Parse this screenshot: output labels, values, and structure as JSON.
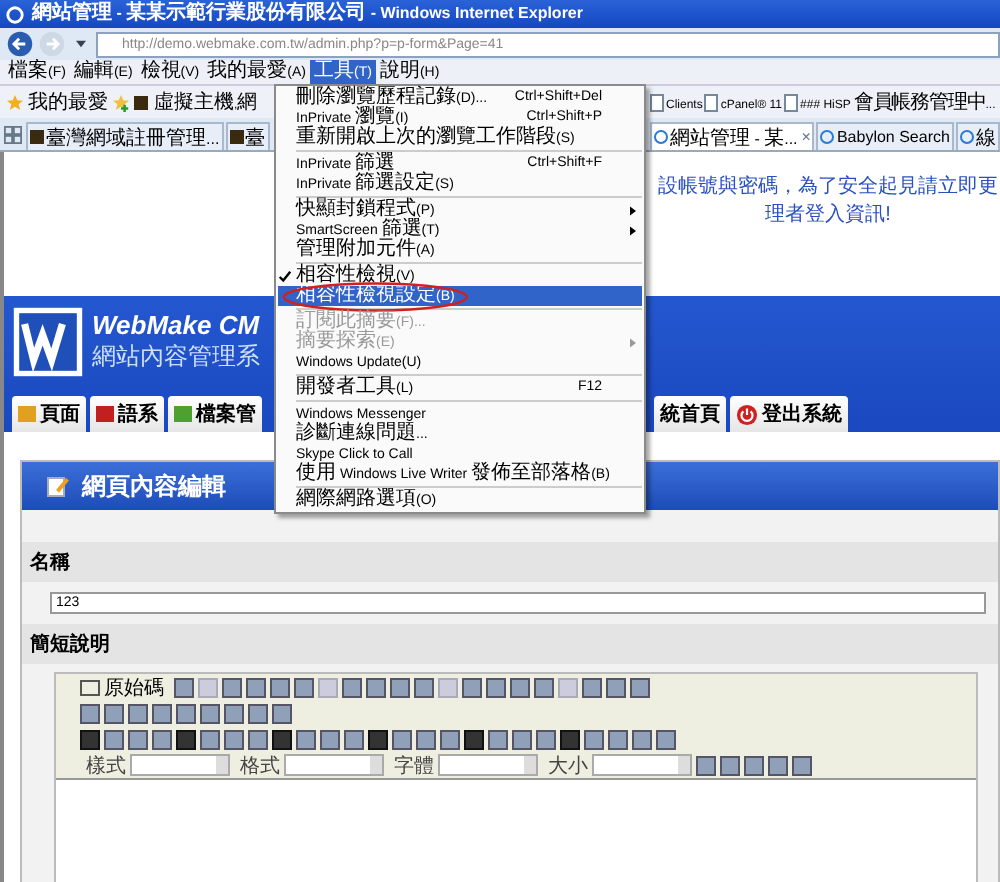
{
  "window": {
    "title": "網站管理 - 某某示範行業股份有限公司 - Windows Internet Explorer"
  },
  "address_bar": {
    "url": "http://demo.webmake.com.tw/admin.php?p=p-form&Page=41"
  },
  "menu_bar": [
    {
      "label": "檔案(F)",
      "selected": false
    },
    {
      "label": "編輯(E)",
      "selected": false
    },
    {
      "label": "檢視(V)",
      "selected": false
    },
    {
      "label": "我的最愛(A)",
      "selected": false
    },
    {
      "label": "工具(T)",
      "selected": true
    },
    {
      "label": "說明(H)",
      "selected": false
    }
  ],
  "favorites_bar": {
    "label": "我的最愛",
    "links_left": [
      "虛擬主機,網"
    ],
    "links_right": [
      "Clients",
      "cPanel® 11",
      "### HiSP 會員帳務管理中..."
    ]
  },
  "browser_tabs_left": [
    {
      "label": "臺灣網域註冊管理...",
      "selected": false
    },
    {
      "label": "臺",
      "selected": false
    }
  ],
  "browser_tabs_right": [
    {
      "label": "網站管理 - 某...",
      "selected": true
    },
    {
      "label": "Babylon Search",
      "selected": false
    },
    {
      "label": "線",
      "selected": false
    }
  ],
  "close_tab": "×",
  "tools_menu": [
    [
      {
        "label": "刪除瀏覽歷程記錄(D)...",
        "shortcut": "Ctrl+Shift+Del",
        "checked": false,
        "selected": false,
        "disabled": false,
        "has_submenu": false,
        "circled": false
      },
      {
        "label": "InPrivate 瀏覽(I)",
        "shortcut": "Ctrl+Shift+P",
        "checked": false,
        "selected": false,
        "disabled": false,
        "has_submenu": false,
        "circled": false
      },
      {
        "label": "重新開啟上次的瀏覽工作階段(S)",
        "checked": false,
        "selected": false,
        "disabled": false,
        "has_submenu": false,
        "circled": false
      }
    ],
    [
      {
        "label": "InPrivate 篩選",
        "shortcut": "Ctrl+Shift+F",
        "checked": false,
        "selected": false,
        "disabled": false,
        "has_submenu": false,
        "circled": false
      },
      {
        "label": "InPrivate 篩選設定(S)",
        "checked": false,
        "selected": false,
        "disabled": false,
        "has_submenu": false,
        "circled": false
      }
    ],
    [
      {
        "label": "快顯封鎖程式(P)",
        "checked": false,
        "selected": false,
        "disabled": false,
        "has_submenu": true,
        "circled": false
      },
      {
        "label": "SmartScreen 篩選(T)",
        "checked": false,
        "selected": false,
        "disabled": false,
        "has_submenu": true,
        "circled": false
      },
      {
        "label": "管理附加元件(A)",
        "checked": false,
        "selected": false,
        "disabled": false,
        "has_submenu": false,
        "circled": false
      }
    ],
    [
      {
        "label": "相容性檢視(V)",
        "checked": true,
        "selected": false,
        "disabled": false,
        "has_submenu": false,
        "circled": false
      },
      {
        "label": "相容性檢視設定(B)",
        "checked": false,
        "selected": true,
        "disabled": false,
        "has_submenu": false,
        "circled": true
      }
    ],
    [
      {
        "label": "訂閱此摘要(F)...",
        "checked": false,
        "selected": false,
        "disabled": true,
        "has_submenu": false,
        "circled": false
      },
      {
        "label": "摘要探索(E)",
        "checked": false,
        "selected": false,
        "disabled": true,
        "has_submenu": true,
        "circled": false
      },
      {
        "label": "Windows Update(U)",
        "checked": false,
        "selected": false,
        "disabled": false,
        "has_submenu": false,
        "circled": false
      }
    ],
    [
      {
        "label": "開發者工具(L)",
        "shortcut": "F12",
        "checked": false,
        "selected": false,
        "disabled": false,
        "has_submenu": false,
        "circled": false
      }
    ],
    [
      {
        "label": "Windows Messenger",
        "checked": false,
        "selected": false,
        "disabled": false,
        "has_submenu": false,
        "circled": false
      },
      {
        "label": "診斷連線問題...",
        "checked": false,
        "selected": false,
        "disabled": false,
        "has_submenu": false,
        "circled": false
      },
      {
        "label": "Skype Click to Call",
        "checked": false,
        "selected": false,
        "disabled": false,
        "has_submenu": false,
        "circled": false
      },
      {
        "label": "使用 Windows Live Writer 發佈至部落格(B)",
        "checked": false,
        "selected": false,
        "disabled": false,
        "has_submenu": false,
        "circled": false
      }
    ],
    [
      {
        "label": "網際網路選項(O)",
        "checked": false,
        "selected": false,
        "disabled": false,
        "has_submenu": false,
        "circled": false
      }
    ]
  ],
  "notice": [
    "設帳號與密碼，為了安全起見請立即更",
    "理者登入資訊!"
  ],
  "logo": {
    "title": "WebMake CM",
    "subtitle": "網站內容管理系"
  },
  "nav_tabs_left": [
    "頁面",
    "語系",
    "檔案管"
  ],
  "nav_tabs_right": [
    "統首頁",
    "登出系統"
  ],
  "panel": {
    "title": "網頁內容編輯"
  },
  "fields": {
    "name_label": "名稱",
    "name_value": "123",
    "summary_label": "簡短說明"
  },
  "editor": {
    "source_button": "原始碼",
    "dropdowns": [
      "樣式",
      "格式",
      "字體",
      "大小"
    ]
  }
}
